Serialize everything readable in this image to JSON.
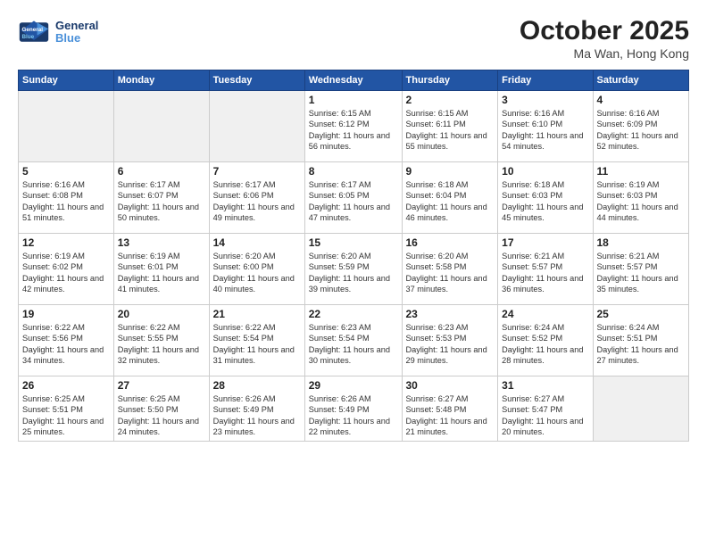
{
  "header": {
    "logo_line1": "General",
    "logo_line2": "Blue",
    "month": "October 2025",
    "location": "Ma Wan, Hong Kong"
  },
  "weekdays": [
    "Sunday",
    "Monday",
    "Tuesday",
    "Wednesday",
    "Thursday",
    "Friday",
    "Saturday"
  ],
  "weeks": [
    [
      {
        "day": "",
        "empty": true
      },
      {
        "day": "",
        "empty": true
      },
      {
        "day": "",
        "empty": true
      },
      {
        "day": "1",
        "sunrise": "6:15 AM",
        "sunset": "6:12 PM",
        "daylight": "11 hours and 56 minutes."
      },
      {
        "day": "2",
        "sunrise": "6:15 AM",
        "sunset": "6:11 PM",
        "daylight": "11 hours and 55 minutes."
      },
      {
        "day": "3",
        "sunrise": "6:16 AM",
        "sunset": "6:10 PM",
        "daylight": "11 hours and 54 minutes."
      },
      {
        "day": "4",
        "sunrise": "6:16 AM",
        "sunset": "6:09 PM",
        "daylight": "11 hours and 52 minutes."
      }
    ],
    [
      {
        "day": "5",
        "sunrise": "6:16 AM",
        "sunset": "6:08 PM",
        "daylight": "11 hours and 51 minutes."
      },
      {
        "day": "6",
        "sunrise": "6:17 AM",
        "sunset": "6:07 PM",
        "daylight": "11 hours and 50 minutes."
      },
      {
        "day": "7",
        "sunrise": "6:17 AM",
        "sunset": "6:06 PM",
        "daylight": "11 hours and 49 minutes."
      },
      {
        "day": "8",
        "sunrise": "6:17 AM",
        "sunset": "6:05 PM",
        "daylight": "11 hours and 47 minutes."
      },
      {
        "day": "9",
        "sunrise": "6:18 AM",
        "sunset": "6:04 PM",
        "daylight": "11 hours and 46 minutes."
      },
      {
        "day": "10",
        "sunrise": "6:18 AM",
        "sunset": "6:03 PM",
        "daylight": "11 hours and 45 minutes."
      },
      {
        "day": "11",
        "sunrise": "6:19 AM",
        "sunset": "6:03 PM",
        "daylight": "11 hours and 44 minutes."
      }
    ],
    [
      {
        "day": "12",
        "sunrise": "6:19 AM",
        "sunset": "6:02 PM",
        "daylight": "11 hours and 42 minutes."
      },
      {
        "day": "13",
        "sunrise": "6:19 AM",
        "sunset": "6:01 PM",
        "daylight": "11 hours and 41 minutes."
      },
      {
        "day": "14",
        "sunrise": "6:20 AM",
        "sunset": "6:00 PM",
        "daylight": "11 hours and 40 minutes."
      },
      {
        "day": "15",
        "sunrise": "6:20 AM",
        "sunset": "5:59 PM",
        "daylight": "11 hours and 39 minutes."
      },
      {
        "day": "16",
        "sunrise": "6:20 AM",
        "sunset": "5:58 PM",
        "daylight": "11 hours and 37 minutes."
      },
      {
        "day": "17",
        "sunrise": "6:21 AM",
        "sunset": "5:57 PM",
        "daylight": "11 hours and 36 minutes."
      },
      {
        "day": "18",
        "sunrise": "6:21 AM",
        "sunset": "5:57 PM",
        "daylight": "11 hours and 35 minutes."
      }
    ],
    [
      {
        "day": "19",
        "sunrise": "6:22 AM",
        "sunset": "5:56 PM",
        "daylight": "11 hours and 34 minutes."
      },
      {
        "day": "20",
        "sunrise": "6:22 AM",
        "sunset": "5:55 PM",
        "daylight": "11 hours and 32 minutes."
      },
      {
        "day": "21",
        "sunrise": "6:22 AM",
        "sunset": "5:54 PM",
        "daylight": "11 hours and 31 minutes."
      },
      {
        "day": "22",
        "sunrise": "6:23 AM",
        "sunset": "5:54 PM",
        "daylight": "11 hours and 30 minutes."
      },
      {
        "day": "23",
        "sunrise": "6:23 AM",
        "sunset": "5:53 PM",
        "daylight": "11 hours and 29 minutes."
      },
      {
        "day": "24",
        "sunrise": "6:24 AM",
        "sunset": "5:52 PM",
        "daylight": "11 hours and 28 minutes."
      },
      {
        "day": "25",
        "sunrise": "6:24 AM",
        "sunset": "5:51 PM",
        "daylight": "11 hours and 27 minutes."
      }
    ],
    [
      {
        "day": "26",
        "sunrise": "6:25 AM",
        "sunset": "5:51 PM",
        "daylight": "11 hours and 25 minutes."
      },
      {
        "day": "27",
        "sunrise": "6:25 AM",
        "sunset": "5:50 PM",
        "daylight": "11 hours and 24 minutes."
      },
      {
        "day": "28",
        "sunrise": "6:26 AM",
        "sunset": "5:49 PM",
        "daylight": "11 hours and 23 minutes."
      },
      {
        "day": "29",
        "sunrise": "6:26 AM",
        "sunset": "5:49 PM",
        "daylight": "11 hours and 22 minutes."
      },
      {
        "day": "30",
        "sunrise": "6:27 AM",
        "sunset": "5:48 PM",
        "daylight": "11 hours and 21 minutes."
      },
      {
        "day": "31",
        "sunrise": "6:27 AM",
        "sunset": "5:47 PM",
        "daylight": "11 hours and 20 minutes."
      },
      {
        "day": "",
        "empty": true
      }
    ]
  ]
}
